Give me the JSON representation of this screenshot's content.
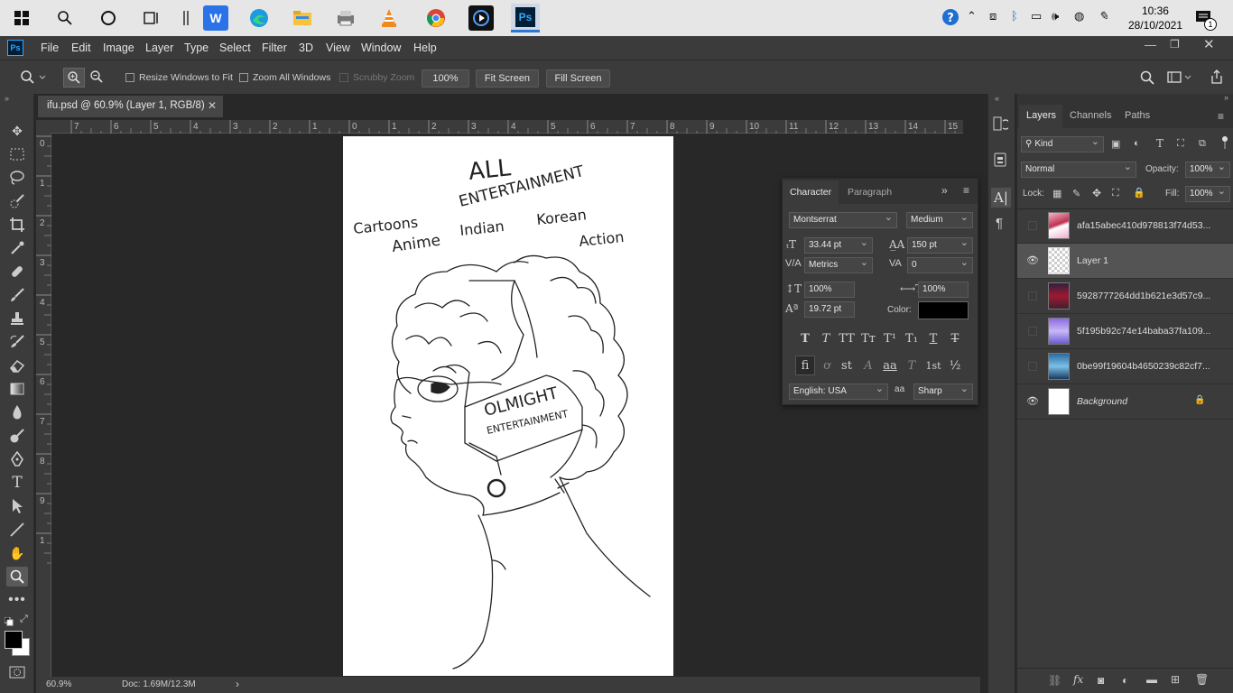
{
  "taskbar": {
    "time": "10:36",
    "date": "28/10/2021",
    "notification_count": "1",
    "apps": [
      "windows-start",
      "search",
      "cortana",
      "task-view",
      "wps-office",
      "edge",
      "file-explorer",
      "printer",
      "vlc",
      "chrome",
      "media-player",
      "photoshop"
    ]
  },
  "menubar": {
    "app_icon": "Ps",
    "items": [
      "File",
      "Edit",
      "Image",
      "Layer",
      "Type",
      "Select",
      "Filter",
      "3D",
      "View",
      "Window",
      "Help"
    ]
  },
  "options": {
    "resize_windows": "Resize Windows to Fit",
    "zoom_all": "Zoom All Windows",
    "scrubby": "Scrubby Zoom",
    "zoom_value": "100%",
    "fit_screen": "Fit Screen",
    "fill_screen": "Fill Screen"
  },
  "document": {
    "tab_title": "ifu.psd @ 60.9% (Layer 1, RGB/8)",
    "zoom": "60.9%",
    "doc_info": "Doc: 1.69M/12.3M",
    "ruler_h": [
      "7",
      "6",
      "5",
      "4",
      "3",
      "2",
      "1",
      "0",
      "1",
      "2",
      "3",
      "4",
      "5",
      "6",
      "7",
      "8",
      "9",
      "10",
      "11",
      "12",
      "13",
      "14",
      "15"
    ],
    "ruler_v": [
      "0",
      "1",
      "2",
      "3",
      "4",
      "5",
      "6",
      "7",
      "8",
      "9",
      "1"
    ]
  },
  "character": {
    "tab_character": "Character",
    "tab_paragraph": "Paragraph",
    "font_family": "Montserrat",
    "font_style": "Medium",
    "font_size": "33.44 pt",
    "leading": "150 pt",
    "kerning": "Metrics",
    "tracking": "0",
    "vertical_scale": "100%",
    "horizontal_scale": "100%",
    "baseline_shift": "19.72 pt",
    "color_label": "Color:",
    "color": "#000000",
    "language": "English: USA",
    "aa_label": "a",
    "antialias": "Sharp",
    "style_buttons": [
      "T",
      "T",
      "TT",
      "Tт",
      "T¹",
      "T₁",
      "T",
      "T"
    ],
    "ot_buttons": [
      "fi",
      "ơ",
      "st",
      "A",
      "aa",
      "T",
      "1st",
      "½"
    ]
  },
  "layers": {
    "tabs": [
      "Layers",
      "Channels",
      "Paths"
    ],
    "filter_kind": "Kind",
    "blend_mode": "Normal",
    "opacity_label": "Opacity:",
    "opacity": "100%",
    "lock_label": "Lock:",
    "fill_label": "Fill:",
    "fill": "100%",
    "items": [
      {
        "name": "afa15abec410d978813f74d53...",
        "visible": false
      },
      {
        "name": "Layer 1",
        "visible": true
      },
      {
        "name": "5928777264dd1b621e3d57c9...",
        "visible": false
      },
      {
        "name": "5f195b92c74e14baba37fa109...",
        "visible": false
      },
      {
        "name": "0be99f19604b4650239c82cf7...",
        "visible": false
      },
      {
        "name": "Background",
        "visible": true
      }
    ]
  },
  "sketch": {
    "title_line1": "ALL",
    "title_line2": "ENTERTAINMENT",
    "genres": [
      "Cartoons",
      "Anime",
      "Indian",
      "Korean",
      "Action"
    ],
    "mask_text1": "OLMIGHT",
    "mask_text2": "ENTERTAINMENT"
  },
  "colors": {
    "ui_bg": "#3b3b3b",
    "workspace": "#282828",
    "accent_ps": "#31a8ff"
  }
}
